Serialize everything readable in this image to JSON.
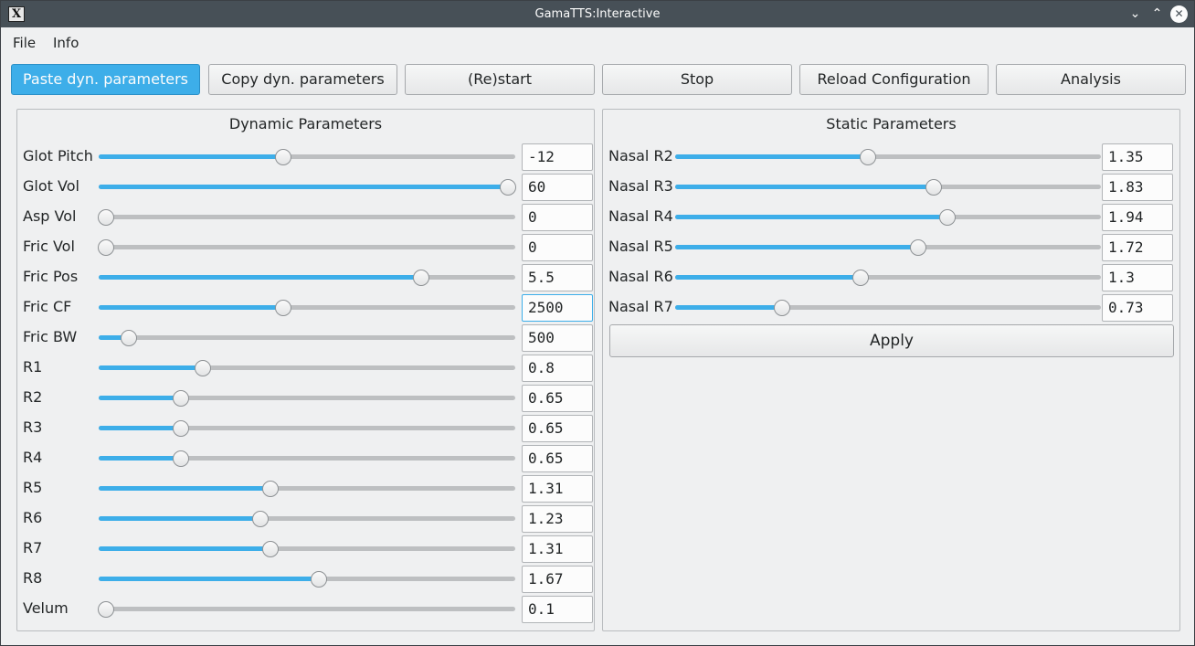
{
  "window": {
    "title": "GamaTTS:Interactive",
    "app_icon": "X",
    "minimize_icon": "chevron-down",
    "maximize_icon": "chevron-up",
    "close_icon": "close"
  },
  "menu": [
    "File",
    "Info"
  ],
  "toolbar": [
    {
      "label": "Paste dyn. parameters",
      "primary": true
    },
    {
      "label": "Copy dyn. parameters",
      "primary": false
    },
    {
      "label": "(Re)start",
      "primary": false
    },
    {
      "label": "Stop",
      "primary": false
    },
    {
      "label": "Reload Configuration",
      "primary": false
    },
    {
      "label": "Analysis",
      "primary": false
    }
  ],
  "dynamic": {
    "title": "Dynamic Parameters",
    "params": [
      {
        "label": "Glot Pitch",
        "value": "-12",
        "level": 0.44
      },
      {
        "label": "Glot Vol",
        "value": "60",
        "level": 1.0
      },
      {
        "label": "Asp Vol",
        "value": "0",
        "level": 0.0
      },
      {
        "label": "Fric Vol",
        "value": "0",
        "level": 0.0
      },
      {
        "label": "Fric Pos",
        "value": "5.5",
        "level": 0.785
      },
      {
        "label": "Fric CF",
        "value": "2500",
        "level": 0.44,
        "focused": true
      },
      {
        "label": "Fric BW",
        "value": "500",
        "level": 0.057
      },
      {
        "label": "R1",
        "value": "0.8",
        "level": 0.24
      },
      {
        "label": "R2",
        "value": "0.65",
        "level": 0.186
      },
      {
        "label": "R3",
        "value": "0.65",
        "level": 0.186
      },
      {
        "label": "R4",
        "value": "0.65",
        "level": 0.186
      },
      {
        "label": "R5",
        "value": "1.31",
        "level": 0.41
      },
      {
        "label": "R6",
        "value": "1.23",
        "level": 0.384
      },
      {
        "label": "R7",
        "value": "1.31",
        "level": 0.41
      },
      {
        "label": "R8",
        "value": "1.67",
        "level": 0.53
      },
      {
        "label": "Velum",
        "value": "0.1",
        "level": 0.0
      }
    ]
  },
  "static": {
    "title": "Static Parameters",
    "apply_label": "Apply",
    "params": [
      {
        "label": "Nasal R2",
        "value": "1.35",
        "level": 0.45
      },
      {
        "label": "Nasal R3",
        "value": "1.83",
        "level": 0.61
      },
      {
        "label": "Nasal R4",
        "value": "1.94",
        "level": 0.645
      },
      {
        "label": "Nasal R5",
        "value": "1.72",
        "level": 0.573
      },
      {
        "label": "Nasal R6",
        "value": "1.3",
        "level": 0.433
      },
      {
        "label": "Nasal R7",
        "value": "0.73",
        "level": 0.243
      }
    ]
  },
  "colors": {
    "accent": "#3daee9",
    "titlebar": "#475057",
    "background": "#eff0f1",
    "groove": "#bdbfc1"
  }
}
